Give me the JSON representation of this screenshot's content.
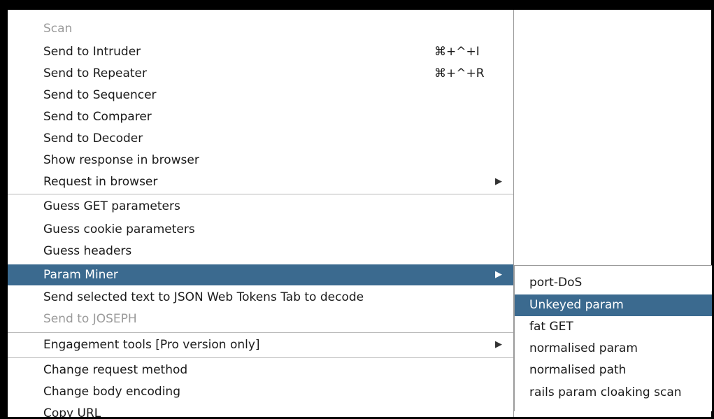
{
  "menu": {
    "items": [
      {
        "label": "Scan",
        "disabled": true
      },
      {
        "label": "Send to Intruder",
        "shortcut": "⌘+^+I"
      },
      {
        "label": "Send to Repeater",
        "shortcut": "⌘+^+R"
      },
      {
        "label": "Send to Sequencer"
      },
      {
        "label": "Send to Comparer"
      },
      {
        "label": "Send to Decoder"
      },
      {
        "label": "Show response in browser"
      },
      {
        "label": "Request in browser",
        "submenu_arrow": "▶"
      },
      {
        "label": "Guess GET parameters"
      },
      {
        "label": "Guess cookie parameters"
      },
      {
        "label": "Guess headers"
      },
      {
        "label": "Param Miner",
        "submenu_arrow": "▶",
        "highlighted": true
      },
      {
        "label": "Send selected text to JSON Web Tokens Tab to decode"
      },
      {
        "label": "Send to JOSEPH",
        "disabled": true
      },
      {
        "label": "Engagement tools [Pro version only]",
        "submenu_arrow": "▶"
      },
      {
        "label": "Change request method"
      },
      {
        "label": "Change body encoding"
      },
      {
        "label": "Copy URL"
      }
    ]
  },
  "submenu": {
    "items": [
      {
        "label": "port-DoS"
      },
      {
        "label": "Unkeyed param",
        "highlighted": true
      },
      {
        "label": "fat GET"
      },
      {
        "label": "normalised param"
      },
      {
        "label": "normalised path"
      },
      {
        "label": "rails param cloaking scan"
      }
    ]
  },
  "colors": {
    "highlight": "#3b6a8f",
    "disabled_text": "#9a9a9a",
    "frame": "#000000"
  }
}
